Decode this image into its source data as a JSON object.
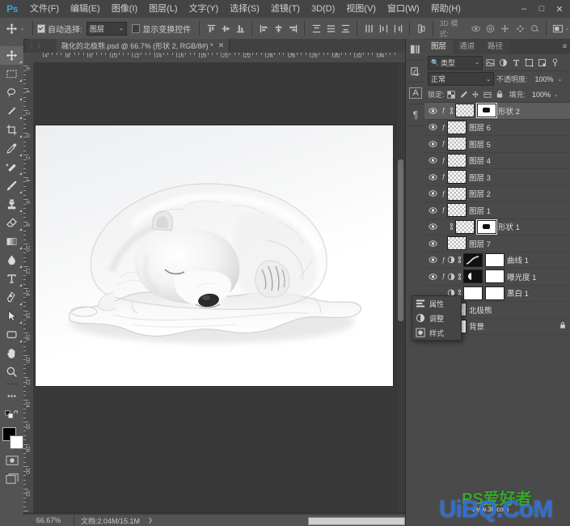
{
  "app": {
    "name": "Ps",
    "window_buttons": [
      "–",
      "□",
      "✕"
    ]
  },
  "menu": {
    "items": [
      {
        "label": "文件(F)"
      },
      {
        "label": "编辑(E)"
      },
      {
        "label": "图像(I)"
      },
      {
        "label": "图层(L)"
      },
      {
        "label": "文字(Y)"
      },
      {
        "label": "选择(S)"
      },
      {
        "label": "滤镜(T)"
      },
      {
        "label": "3D(D)"
      },
      {
        "label": "视图(V)"
      },
      {
        "label": "窗口(W)"
      },
      {
        "label": "帮助(H)"
      }
    ]
  },
  "options_bar": {
    "tool_icon": "move-tool-icon",
    "auto_select_label": "自动选择:",
    "auto_select_checked": true,
    "auto_select_scope": "图层",
    "show_transform_label": "显示变换控件",
    "show_transform_checked": false,
    "align_icons": [
      "align-top-edges-icon",
      "align-vertical-centers-icon",
      "align-bottom-edges-icon",
      "align-left-edges-icon",
      "align-horizontal-centers-icon",
      "align-right-edges-icon"
    ],
    "distribute_icons": [
      "distribute-top-icon",
      "distribute-vertical-center-icon",
      "distribute-bottom-icon",
      "distribute-left-icon",
      "distribute-horizontal-center-icon",
      "distribute-right-icon"
    ],
    "auto_align_icon": "auto-align-layers-icon",
    "mode_3d_label": "3D 模式:",
    "mode_3d_icons": [
      "rotate-3d-icon",
      "roll-3d-icon",
      "pan-3d-icon",
      "slide-3d-icon",
      "scale-3d-icon"
    ],
    "workspace_icon": "workspace-switcher-icon"
  },
  "document": {
    "tab_title": "融化的北极熊.psd @ 66.7% (形状 2, RGB/8#) *",
    "close_glyph": "✕"
  },
  "toolbar": {
    "tools": [
      {
        "name": "move-tool",
        "active": true
      },
      {
        "name": "rectangular-marquee-tool",
        "active": false
      },
      {
        "name": "lasso-tool",
        "active": false
      },
      {
        "name": "quick-selection-tool",
        "active": false
      },
      {
        "name": "crop-tool",
        "active": false
      },
      {
        "name": "eyedropper-tool",
        "active": false
      },
      {
        "name": "spot-healing-brush-tool",
        "active": false
      },
      {
        "name": "brush-tool",
        "active": false
      },
      {
        "name": "clone-stamp-tool",
        "active": false
      },
      {
        "name": "eraser-tool",
        "active": false
      },
      {
        "name": "gradient-tool",
        "active": false
      },
      {
        "name": "blur-tool",
        "active": false
      },
      {
        "name": "type-tool",
        "active": false
      },
      {
        "name": "pen-tool",
        "active": false
      },
      {
        "name": "path-selection-tool",
        "active": false
      },
      {
        "name": "rectangle-shape-tool",
        "active": false
      },
      {
        "name": "hand-tool",
        "active": false
      },
      {
        "name": "zoom-tool",
        "active": false
      },
      {
        "name": "edit-toolbar-tool",
        "active": false
      }
    ],
    "quick_mask_icon": "quick-mask-icon",
    "screen_mode_icon": "screen-mode-icon",
    "foreground_color": "#000000",
    "background_color": "#ffffff"
  },
  "rulers": {
    "unit": "cm",
    "horizontal_ticks": [
      "4",
      "6",
      "8",
      "10",
      "12",
      "14",
      "16",
      "18",
      "20",
      "22",
      "24",
      "26",
      "28",
      "30",
      "32",
      "34"
    ],
    "vertical_ticks": [
      "6",
      "4",
      "2",
      "0",
      "2",
      "4",
      "6",
      "8",
      "10",
      "12",
      "14",
      "16",
      "18",
      "20",
      "22",
      "24",
      "26",
      "28",
      "30",
      "32",
      "34"
    ]
  },
  "canvas": {
    "artwork_name": "melting-polar-bear-artwork",
    "background_color": "#ffffff",
    "pasteboard_color": "#393939"
  },
  "status_bar": {
    "zoom": "66.67%",
    "doc_info": "文档:2.04M/15.1M",
    "expander_glyph": "❯"
  },
  "dock_rail": {
    "buttons": [
      {
        "name": "color-swatches-panel-icon"
      },
      {
        "name": "history-panel-icon"
      },
      {
        "name": "character-panel-icon",
        "glyph": "A"
      },
      {
        "name": "paragraph-panel-icon",
        "glyph": "¶"
      }
    ]
  },
  "layers_panel": {
    "tabs": [
      {
        "label": "图层",
        "active": true
      },
      {
        "label": "通道",
        "active": false
      },
      {
        "label": "路径",
        "active": false
      }
    ],
    "menu_glyph": "≡",
    "filter": {
      "search_icon": "search-filter-icon",
      "kind_label": "类型",
      "chevron": "⌄",
      "type_icons": [
        "filter-pixel-icon",
        "filter-adjustment-icon",
        "filter-type-icon",
        "filter-shape-icon",
        "filter-smartobject-icon"
      ],
      "toggle_icon": "filter-toggle-icon"
    },
    "blend": {
      "mode": "正常",
      "opacity_label": "不透明度:",
      "opacity_value": "100%",
      "chevron": "⌄"
    },
    "lock": {
      "label": "锁定:",
      "icons": [
        "lock-transparent-pixels-icon",
        "lock-image-pixels-icon",
        "lock-position-icon",
        "lock-artboard-nesting-icon",
        "lock-all-icon"
      ],
      "fill_label": "填充:",
      "fill_value": "100%"
    },
    "layers": [
      {
        "name": "形状 2",
        "visible": true,
        "selected": true,
        "thumb": "vector-shape",
        "fx": true,
        "vector_mask": true,
        "locked": false
      },
      {
        "name": "图层 6",
        "visible": true,
        "selected": false,
        "thumb": "transparent",
        "fx": true,
        "vector_mask": false,
        "locked": false
      },
      {
        "name": "图层 5",
        "visible": true,
        "selected": false,
        "thumb": "transparent",
        "fx": true,
        "vector_mask": false,
        "locked": false
      },
      {
        "name": "图层 4",
        "visible": true,
        "selected": false,
        "thumb": "transparent",
        "fx": true,
        "vector_mask": false,
        "locked": false
      },
      {
        "name": "图层 3",
        "visible": true,
        "selected": false,
        "thumb": "transparent",
        "fx": true,
        "vector_mask": false,
        "locked": false
      },
      {
        "name": "图层 2",
        "visible": true,
        "selected": false,
        "thumb": "transparent",
        "fx": true,
        "vector_mask": false,
        "locked": false
      },
      {
        "name": "图层 1",
        "visible": true,
        "selected": false,
        "thumb": "transparent",
        "fx": true,
        "vector_mask": false,
        "locked": false
      },
      {
        "name": "形状 1",
        "visible": true,
        "selected": false,
        "thumb": "vector-shape",
        "fx": false,
        "vector_mask": true,
        "locked": false
      },
      {
        "name": "图层 7",
        "visible": true,
        "selected": false,
        "thumb": "transparent",
        "fx": false,
        "vector_mask": false,
        "locked": false
      },
      {
        "name": "曲线 1",
        "visible": true,
        "selected": false,
        "thumb": "curves-adjustment",
        "fx": true,
        "vector_mask": true,
        "locked": false
      },
      {
        "name": "曝光度 1",
        "visible": true,
        "selected": false,
        "thumb": "exposure-adjustment",
        "fx": true,
        "vector_mask": true,
        "locked": false
      },
      {
        "name": "黑白 1",
        "visible": false,
        "selected": false,
        "thumb": "bw-adjustment",
        "fx": false,
        "vector_mask": true,
        "locked": false
      },
      {
        "name": "北极熊",
        "visible": true,
        "selected": false,
        "thumb": "bear-pixel",
        "fx": false,
        "vector_mask": false,
        "locked": false
      },
      {
        "name": "背景",
        "visible": true,
        "selected": false,
        "thumb": "white-background",
        "fx": false,
        "vector_mask": false,
        "locked": true
      }
    ]
  },
  "floating_panel": {
    "rows": [
      {
        "label": "属性",
        "icon": "properties-panel-icon"
      },
      {
        "label": "调整",
        "icon": "adjustments-panel-icon"
      },
      {
        "label": "样式",
        "icon": "styles-panel-icon"
      }
    ]
  },
  "watermark": {
    "brand_green": "PS爱好者",
    "brand_blue": "UiBQ.CoM",
    "url_small": "www.38.com",
    "green_color": "#36a829",
    "blue_color": "#2f6fd0"
  }
}
